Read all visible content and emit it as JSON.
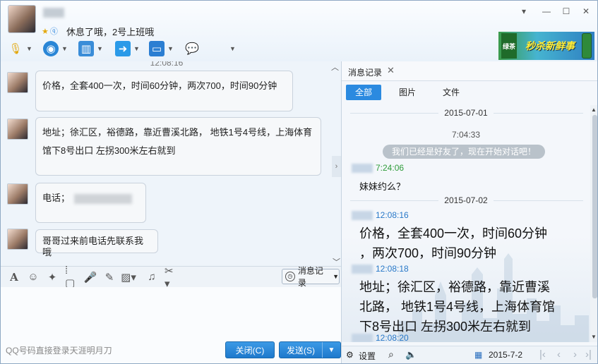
{
  "window": {
    "signature": "休息了哦，2号上班哦",
    "controls": [
      "▾",
      "—",
      "☐",
      "✕"
    ]
  },
  "ad": {
    "text": "秒杀新鲜事",
    "sub": "绿茶"
  },
  "chat": {
    "top_time": "12:08:16",
    "messages": [
      {
        "text": "价格，全套400一次，时间60分钟，两次700，时间90分钟"
      },
      {
        "line1": "地址；徐汇区，裕德路，靠近曹溪北路， 地铁1号4号线，上海体育",
        "line2": "馆下8号出口  左拐300米左右就到"
      },
      {
        "label": "电话；"
      },
      {
        "text": "哥哥过来前电话先联系我哦"
      }
    ]
  },
  "input": {
    "history_button": "消息记录",
    "hint": "QQ号码直接登录天涯明月刀",
    "close_button": "关闭(C)",
    "send_button": "发送(S)"
  },
  "history": {
    "tab_label": "消息记录",
    "filters": [
      "全部",
      "图片",
      "文件"
    ],
    "date1": "2015-07-01",
    "time1": "7:04:33",
    "system_msg": "我们已经是好友了，现在开始对话吧！",
    "time2": "7:24:06",
    "text2": "妹妹约么？",
    "date2": "2015-07-02",
    "time3": "12:08:16",
    "text3_l1": "价格，全套400一次，时间60分钟",
    "text3_l2": "，两次700，时间90分钟",
    "time4": "12:08:18",
    "text4_l1": "地址；徐汇区，裕德路，靠近曹溪",
    "text4_l2": "北路， 地铁1号4号线，上海体育馆",
    "text4_l3": "下8号出口  左拐300米左右就到",
    "time5": "12:08:20",
    "settings": "设置",
    "footer_date": "2015-7-2"
  },
  "colors": {
    "accent": "#2b8ae0",
    "online_time": "#2e9c3a",
    "self_time": "#2878c8"
  }
}
